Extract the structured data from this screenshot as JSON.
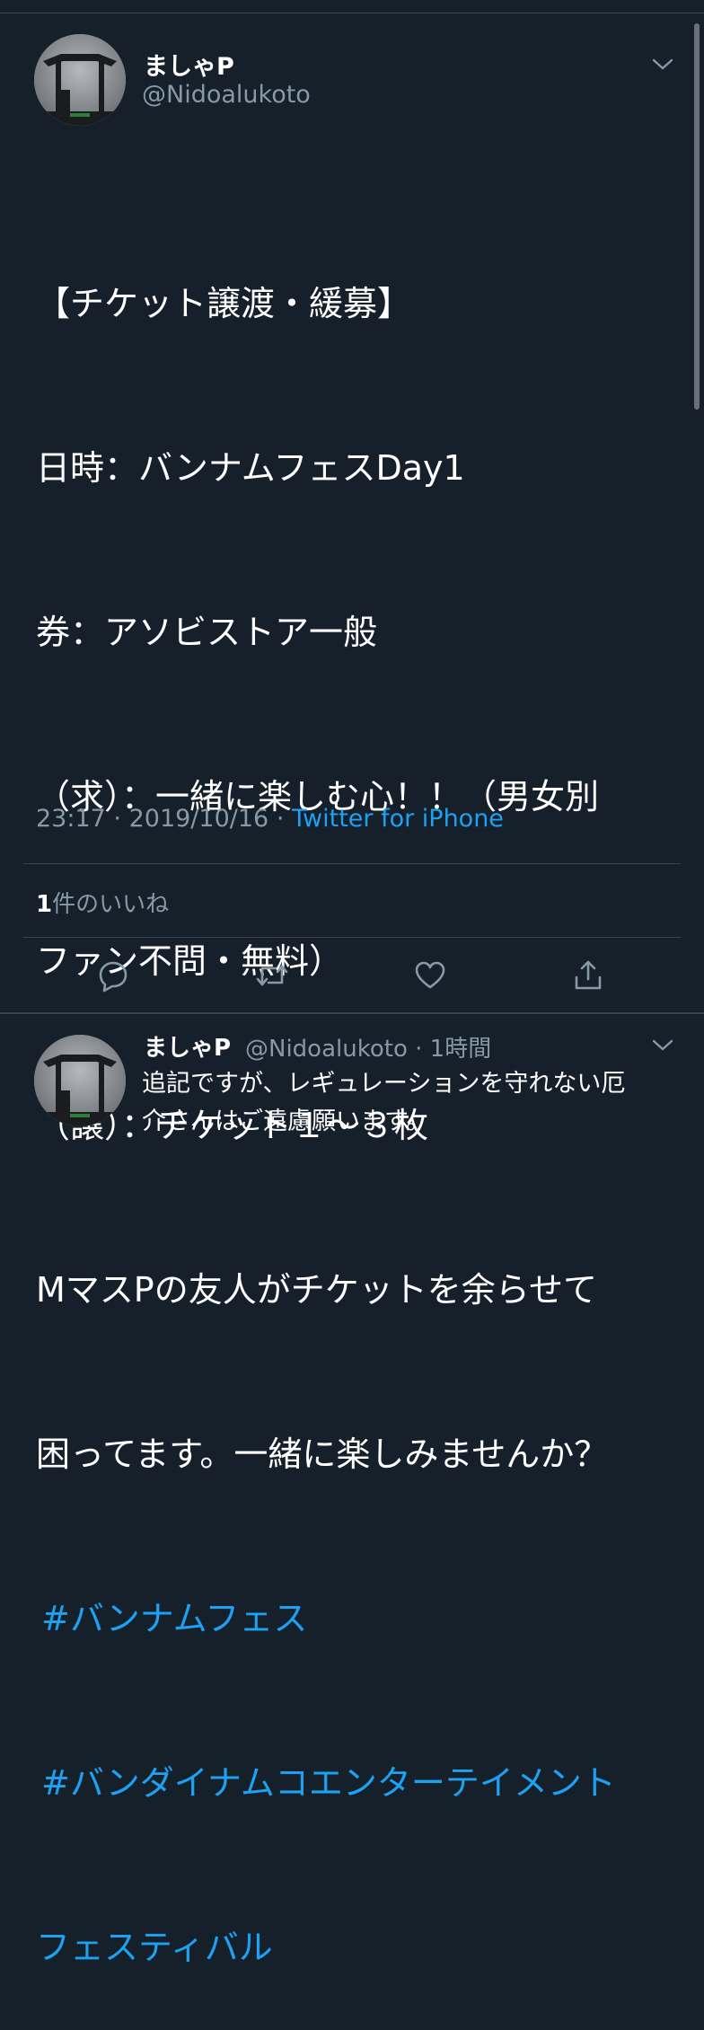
{
  "tweet": {
    "display_name": "ましゃP",
    "handle": "@Nidoalukoto",
    "lines": [
      "【チケット譲渡・緩募】",
      "日時：バンナムフェスDay1",
      "券：アソビストア一般",
      "（求）：一緒に楽しむ心！！（男女別",
      "ファン不問・無料）",
      "（譲）：チケット１〜３枚",
      "MマスPの友人がチケットを余らせて",
      "困ってます。一緒に楽しみませんか？"
    ],
    "hashtags": [
      "#バンナムフェス",
      "#バンダイナムコエンターテイメント",
      "フェスティバル"
    ],
    "time": "23:17",
    "date": "2019/10/16",
    "dot": "·",
    "source": "Twitter for iPhone",
    "likes_count": "1",
    "likes_label": "件のいいね",
    "actions": [
      "reply-icon",
      "retweet-icon",
      "like-icon",
      "share-icon"
    ]
  },
  "reply": {
    "display_name": "ましゃP",
    "handle_time": "@Nidoalukoto · 1時間",
    "lines": [
      "追記ですが、レギュレーションを守れない厄",
      "介さんはご遠慮願います。"
    ]
  },
  "colors": {
    "background": "#15202b",
    "link": "#1da1f2",
    "secondary_text": "#8899a6",
    "divider": "#38444d"
  }
}
